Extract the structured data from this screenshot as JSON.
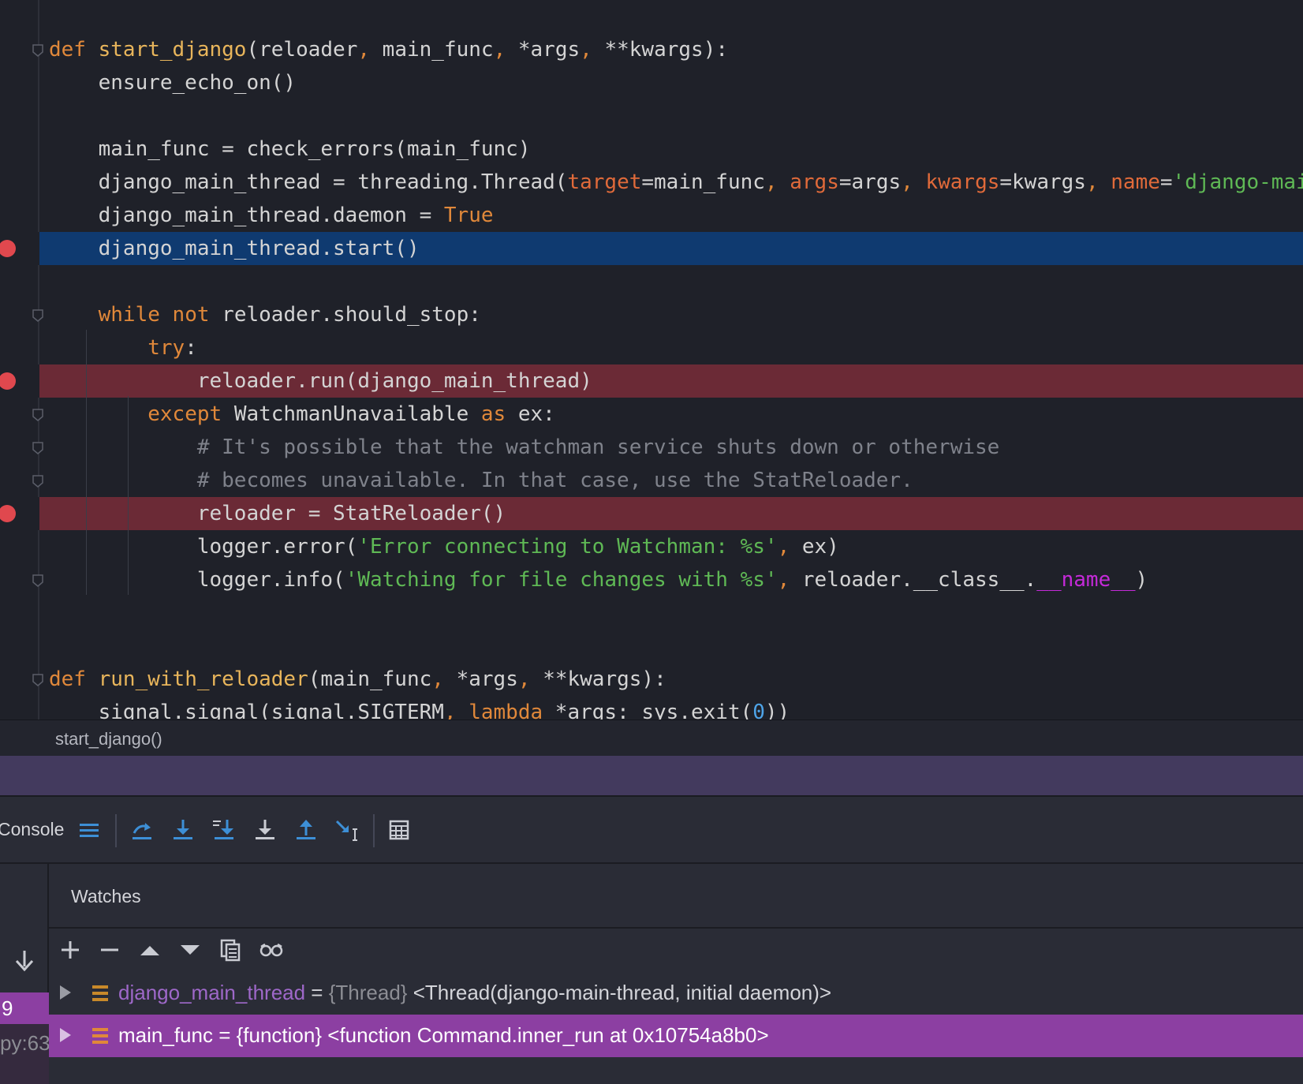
{
  "editor": {
    "lines": [
      [
        {
          "t": "def ",
          "c": "kw"
        },
        {
          "t": "start_django",
          "c": "fn"
        },
        {
          "t": "(reloader"
        },
        {
          "t": ", ",
          "c": "punct"
        },
        {
          "t": "main_func"
        },
        {
          "t": ", ",
          "c": "punct"
        },
        {
          "t": "*args"
        },
        {
          "t": ", ",
          "c": "punct"
        },
        {
          "t": "**kwargs):"
        }
      ],
      [
        {
          "t": "    ensure_echo_on()"
        }
      ],
      [
        {
          "t": ""
        }
      ],
      [
        {
          "t": "    main_func = check_errors(main_func)"
        }
      ],
      [
        {
          "t": "    django_main_thread = threading.Thread("
        },
        {
          "t": "target",
          "c": "param"
        },
        {
          "t": "=main_func"
        },
        {
          "t": ", ",
          "c": "punct"
        },
        {
          "t": "args",
          "c": "param"
        },
        {
          "t": "=args"
        },
        {
          "t": ", ",
          "c": "punct"
        },
        {
          "t": "kwargs",
          "c": "param"
        },
        {
          "t": "=kwargs"
        },
        {
          "t": ", ",
          "c": "punct"
        },
        {
          "t": "name",
          "c": "param"
        },
        {
          "t": "="
        },
        {
          "t": "'django-main-thread'",
          "c": "str"
        },
        {
          "t": ")"
        }
      ],
      [
        {
          "t": "    django_main_thread.daemon = "
        },
        {
          "t": "True",
          "c": "kw"
        }
      ],
      [
        {
          "t": "    django_main_thread.start()"
        }
      ],
      [
        {
          "t": ""
        }
      ],
      [
        {
          "t": "    "
        },
        {
          "t": "while not ",
          "c": "kw"
        },
        {
          "t": "reloader.should_stop:"
        }
      ],
      [
        {
          "t": "        "
        },
        {
          "t": "try",
          "c": "kw"
        },
        {
          "t": ":"
        }
      ],
      [
        {
          "t": "            reloader.run(django_main_thread)"
        }
      ],
      [
        {
          "t": "        "
        },
        {
          "t": "except ",
          "c": "kw"
        },
        {
          "t": "WatchmanUnavailable "
        },
        {
          "t": "as ",
          "c": "kw"
        },
        {
          "t": "ex:"
        }
      ],
      [
        {
          "t": "            "
        },
        {
          "t": "# It's possible that the watchman service shuts down or otherwise",
          "c": "cmt"
        }
      ],
      [
        {
          "t": "            "
        },
        {
          "t": "# becomes unavailable. In that case, use the StatReloader.",
          "c": "cmt"
        }
      ],
      [
        {
          "t": "            reloader = StatReloader()"
        }
      ],
      [
        {
          "t": "            logger.error("
        },
        {
          "t": "'Error connecting to Watchman: %s'",
          "c": "str"
        },
        {
          "t": ", ",
          "c": "punct"
        },
        {
          "t": "ex)"
        }
      ],
      [
        {
          "t": "            logger.info("
        },
        {
          "t": "'Watching for file changes with %s'",
          "c": "str"
        },
        {
          "t": ", ",
          "c": "punct"
        },
        {
          "t": "reloader.__class__."
        },
        {
          "t": "__name__",
          "c": "magic"
        },
        {
          "t": ")"
        }
      ],
      [
        {
          "t": ""
        }
      ],
      [
        {
          "t": ""
        }
      ],
      [
        {
          "t": "def ",
          "c": "kw"
        },
        {
          "t": "run_with_reloader",
          "c": "fn"
        },
        {
          "t": "(main_func"
        },
        {
          "t": ", ",
          "c": "punct"
        },
        {
          "t": "*args"
        },
        {
          "t": ", ",
          "c": "punct"
        },
        {
          "t": "**kwargs):"
        }
      ],
      [
        {
          "t": "    signal.signal(signal.SIGTERM"
        },
        {
          "t": ", ",
          "c": "punct"
        },
        {
          "t": "lambda ",
          "c": "kw"
        },
        {
          "t": "*args: sys.exit("
        },
        {
          "t": "0",
          "c": "num"
        },
        {
          "t": "))"
        }
      ]
    ],
    "current_line": 6,
    "breakpoint_lines": [
      6,
      10,
      14
    ],
    "highlighted_break_lines": [
      10,
      14
    ],
    "fold_lines": [
      0,
      8,
      11,
      12,
      13,
      16,
      19
    ]
  },
  "breadcrumb": "start_django()",
  "toolbar": {
    "console_label": "Console",
    "buttons": [
      "frames-icon",
      "step-over-icon",
      "step-into-icon",
      "step-into-my-code-icon",
      "force-step-into-icon",
      "step-out-icon",
      "run-to-cursor-icon",
      "evaluate-expression-icon"
    ]
  },
  "frames": {
    "frame_number": "9",
    "frame_file": "py:63"
  },
  "watches": {
    "title": "Watches",
    "items": [
      {
        "name": "django_main_thread",
        "eq": " = ",
        "type": "{Thread}",
        "value": " <Thread(django-main-thread, initial daemon)>"
      },
      {
        "name": "main_func",
        "eq": " = ",
        "type": "{function}",
        "value": " <function Command.inner_run at 0x10754a8b0>"
      }
    ],
    "selected_index": 1
  },
  "colors": {
    "current_line": "#0f3a70",
    "breakpoint_line": "#6b2a36",
    "breakpoint_dot": "#e0484e",
    "selection": "#8c3fa2",
    "debug_header": "#433a5e"
  }
}
